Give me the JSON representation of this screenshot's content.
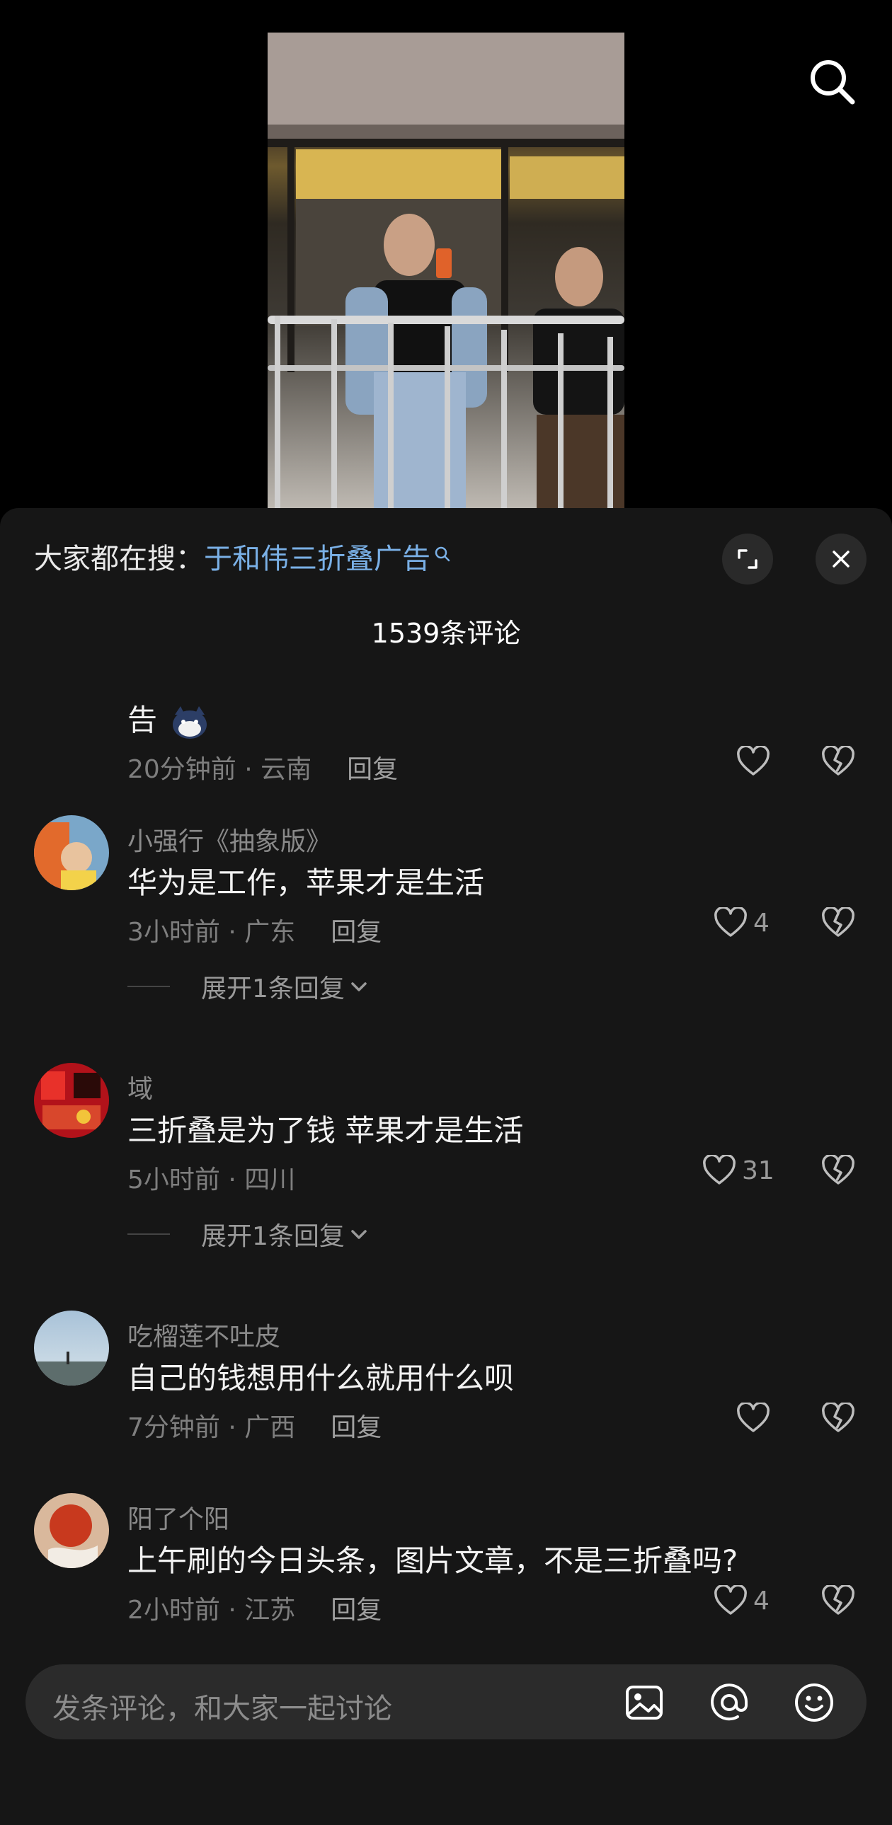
{
  "search_bar": {
    "label": "大家都在搜：",
    "keyword": "于和伟三折叠广告"
  },
  "comments_title": "1539条评论",
  "comments": [
    {
      "text": "告",
      "time_location": "20分钟前 · 云南",
      "reply_label": "回复",
      "likes": ""
    },
    {
      "username": "小强行《抽象版》",
      "text": "华为是工作，苹果才是生活",
      "time_location": "3小时前 · 广东",
      "reply_label": "回复",
      "likes": "4",
      "expand_label": "展开1条回复"
    },
    {
      "username": "域",
      "text": "三折叠是为了钱  苹果才是生活",
      "time_location": "5小时前 · 四川",
      "likes": "31",
      "expand_label": "展开1条回复"
    },
    {
      "username": "吃榴莲不吐皮",
      "text": "自己的钱想用什么就用什么呗",
      "time_location": "7分钟前 · 广西",
      "reply_label": "回复",
      "likes": ""
    },
    {
      "username": "阳了个阳",
      "text": "上午刷的今日头条，图片文章，不是三折叠吗?",
      "time_location": "2小时前 · 江苏",
      "reply_label": "回复",
      "likes": "4"
    }
  ],
  "input": {
    "placeholder": "发条评论，和大家一起讨论"
  },
  "colors": {
    "sheet_bg": "#161616",
    "keyword": "#7ab0e6",
    "input_bg": "#2b2b2b"
  }
}
